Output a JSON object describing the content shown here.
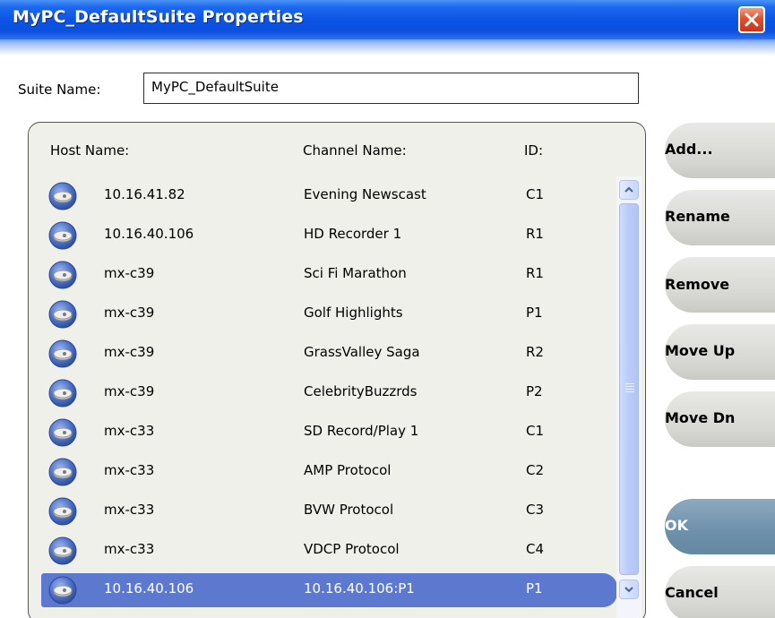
{
  "window": {
    "title": "MyPC_DefaultSuite Properties",
    "close_icon": "close-icon"
  },
  "suite": {
    "label": "Suite Name:",
    "value": "MyPC_DefaultSuite"
  },
  "list": {
    "columns": [
      "Host Name:",
      "Channel Name:",
      "ID:"
    ],
    "rows": [
      {
        "host": "10.16.41.82",
        "channel": "Evening Newscast",
        "id": "C1",
        "selected": false
      },
      {
        "host": "10.16.40.106",
        "channel": "HD Recorder 1",
        "id": "R1",
        "selected": false
      },
      {
        "host": "mx-c39",
        "channel": "Sci Fi Marathon",
        "id": "R1",
        "selected": false
      },
      {
        "host": "mx-c39",
        "channel": "Golf Highlights",
        "id": "P1",
        "selected": false
      },
      {
        "host": "mx-c39",
        "channel": "GrassValley Saga",
        "id": "R2",
        "selected": false
      },
      {
        "host": "mx-c39",
        "channel": "CelebrityBuzzrds",
        "id": "P2",
        "selected": false
      },
      {
        "host": "mx-c33",
        "channel": "SD Record/Play 1",
        "id": "C1",
        "selected": false
      },
      {
        "host": "mx-c33",
        "channel": "AMP Protocol",
        "id": "C2",
        "selected": false
      },
      {
        "host": "mx-c33",
        "channel": "BVW Protocol",
        "id": "C3",
        "selected": false
      },
      {
        "host": "mx-c33",
        "channel": "VDCP Protocol",
        "id": "C4",
        "selected": false
      },
      {
        "host": "10.16.40.106",
        "channel": "10.16.40.106:P1",
        "id": "P1",
        "selected": true
      }
    ],
    "row_icon": "host-disk-icon"
  },
  "buttons": {
    "add": "Add...",
    "rename": "Rename",
    "remove": "Remove",
    "move_up": "Move Up",
    "move_dn": "Move Dn",
    "ok": "OK",
    "cancel": "Cancel"
  },
  "colors": {
    "titlebar": "#0a52e3",
    "selection": "#5d79cf",
    "ok_button": "#6e90aa",
    "side_button": "#d6d6d2",
    "close_button": "#e0502a"
  }
}
